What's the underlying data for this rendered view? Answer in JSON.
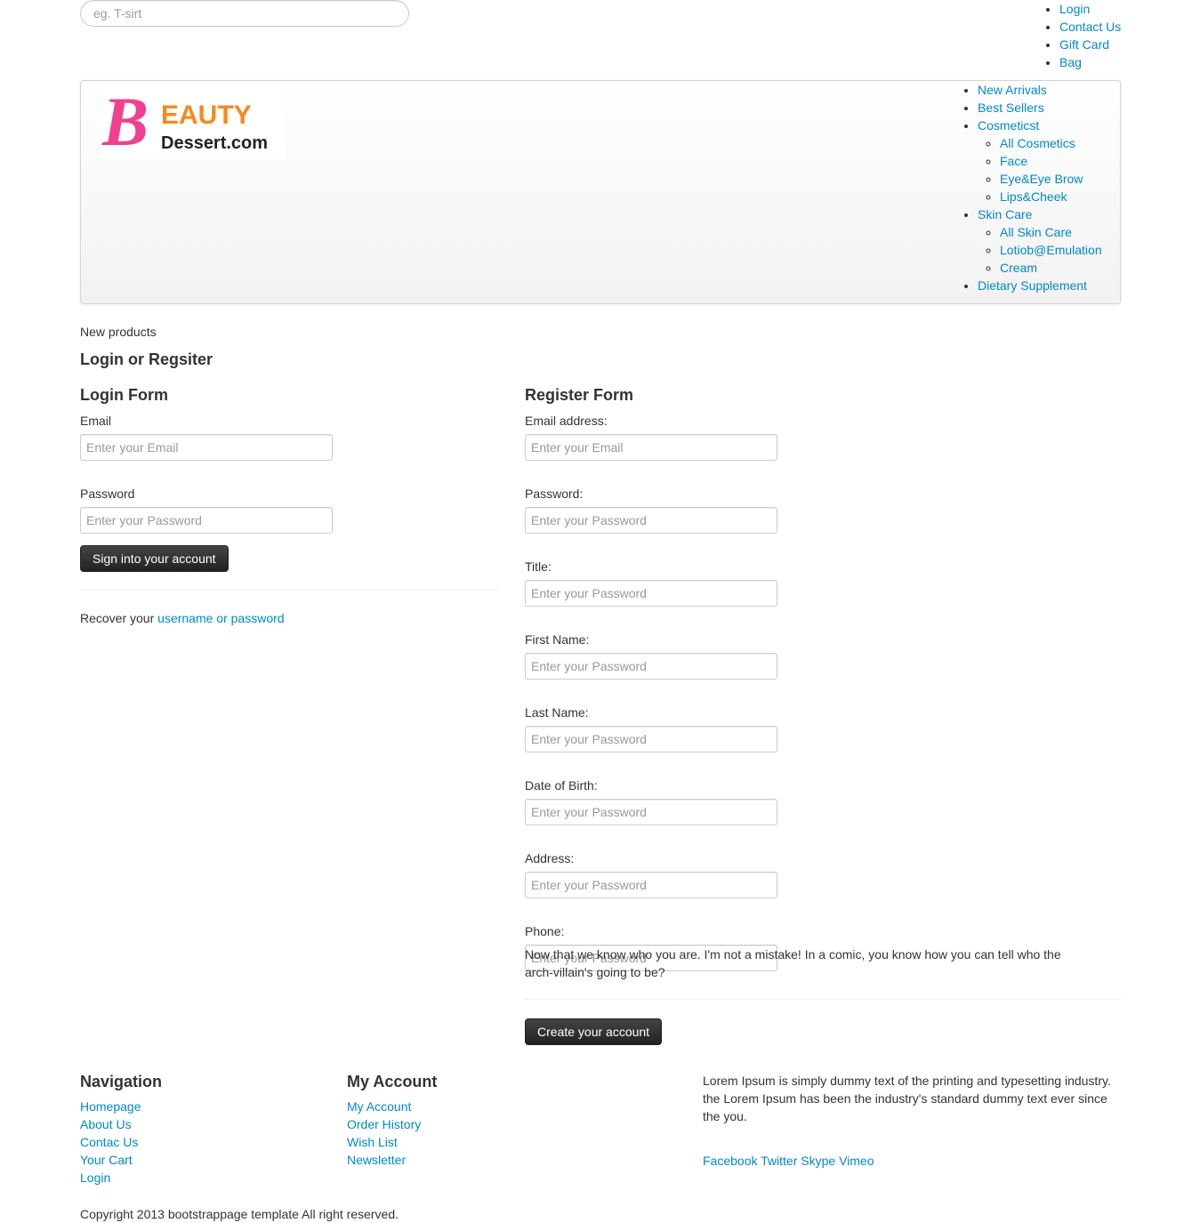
{
  "search": {
    "placeholder": "eg. T-sirt"
  },
  "top_links": [
    "Login",
    "Contact Us",
    "Gift Card",
    "Bag"
  ],
  "logo": {
    "line1_initial": "B",
    "line1_rest": "EAUTY",
    "line2": "Dessert.com"
  },
  "main_nav": {
    "new_arrivals": "New Arrivals",
    "best_sellers": "Best Sellers",
    "cosmetics": {
      "label": "Cosmeticst",
      "items": [
        "All Cosmetics",
        "Face",
        "Eye&Eye Brow",
        "Lips&Cheek"
      ]
    },
    "skin_care": {
      "label": "Skin Care",
      "items": [
        "All Skin Care",
        "Lotiob@Emulation",
        "Cream"
      ]
    },
    "dietary": "Dietary Supplement"
  },
  "breadcrumb": "New products",
  "page_title": "Login or Regsiter",
  "login_form": {
    "title": "Login Form",
    "email_label": "Email",
    "email_placeholder": "Enter your Email",
    "password_label": "Password",
    "password_placeholder": "Enter your Password",
    "submit": "Sign into your account",
    "recover_prefix": "Recover your ",
    "recover_link": "username or password"
  },
  "register_form": {
    "title": "Register Form",
    "fields": [
      {
        "label": "Email address:",
        "placeholder": "Enter your Email"
      },
      {
        "label": "Password:",
        "placeholder": "Enter your Password"
      },
      {
        "label": "Title:",
        "placeholder": "Enter your Password"
      },
      {
        "label": "First Name:",
        "placeholder": "Enter your Password"
      },
      {
        "label": "Last Name:",
        "placeholder": "Enter your Password"
      },
      {
        "label": "Date of Birth:",
        "placeholder": "Enter your Password"
      },
      {
        "label": "Address:",
        "placeholder": "Enter your Password"
      },
      {
        "label": "Phone:",
        "placeholder": "Enter your Password"
      }
    ],
    "note": "Now that we know who you are. I'm not a mistake! In a comic, you know how you can tell who the arch-villain's going to be?",
    "submit": "Create your account"
  },
  "footer": {
    "navigation": {
      "title": "Navigation",
      "items": [
        "Homepage",
        "About Us",
        "Contac Us",
        "Your Cart",
        "Login"
      ]
    },
    "account": {
      "title": "My Account",
      "items": [
        "My Account",
        "Order History",
        "Wish List",
        "Newsletter"
      ]
    },
    "about_text": "Lorem Ipsum is simply dummy text of the printing and typesetting industry. the Lorem Ipsum has been the industry's standard dummy text ever since the you.",
    "social": [
      "Facebook",
      "Twitter",
      "Skype",
      "Vimeo"
    ],
    "copyright": "Copyright 2013 bootstrappage template All right reserved."
  },
  "colors": {
    "link": "#0088cc",
    "text": "#333333",
    "button": "#222222",
    "logo_pink": "#f0408f",
    "logo_orange": "#f58a1f"
  }
}
